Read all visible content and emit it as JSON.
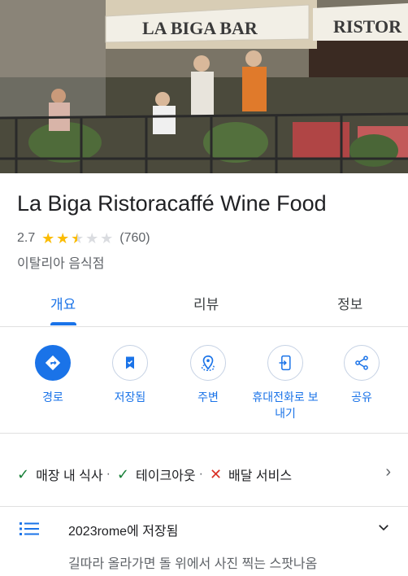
{
  "hero": {
    "photo_alt": "Restaurant exterior photo",
    "awning_left": "LA BIGA BAR",
    "awning_right": "RISTOR"
  },
  "place": {
    "name": "La Biga Ristoracaffé Wine Food",
    "rating": "2.7",
    "rating_value": 2.7,
    "review_count": "(760)",
    "category": "이탈리아 음식점"
  },
  "tabs": [
    {
      "label": "개요",
      "active": true
    },
    {
      "label": "리뷰",
      "active": false
    },
    {
      "label": "정보",
      "active": false
    }
  ],
  "actions": [
    {
      "label": "경로",
      "icon": "directions-icon"
    },
    {
      "label": "저장됨",
      "icon": "bookmark-icon"
    },
    {
      "label": "주변",
      "icon": "nearby-icon"
    },
    {
      "label": "휴대전화로 보내기",
      "icon": "send-to-phone-icon"
    },
    {
      "label": "공유",
      "icon": "share-icon"
    }
  ],
  "services": [
    {
      "label": "매장 내 식사",
      "available": true
    },
    {
      "label": "테이크아웃",
      "available": true
    },
    {
      "label": "배달 서비스",
      "available": false
    }
  ],
  "saved": {
    "label": "2023rome에 저장됨",
    "note": "길따라 올라가면 돌 위에서 사진 찍는 스팟나옴"
  },
  "colors": {
    "accent": "#1a73e8",
    "star": "#fbbc04",
    "check": "#188038",
    "cross": "#d93025"
  }
}
